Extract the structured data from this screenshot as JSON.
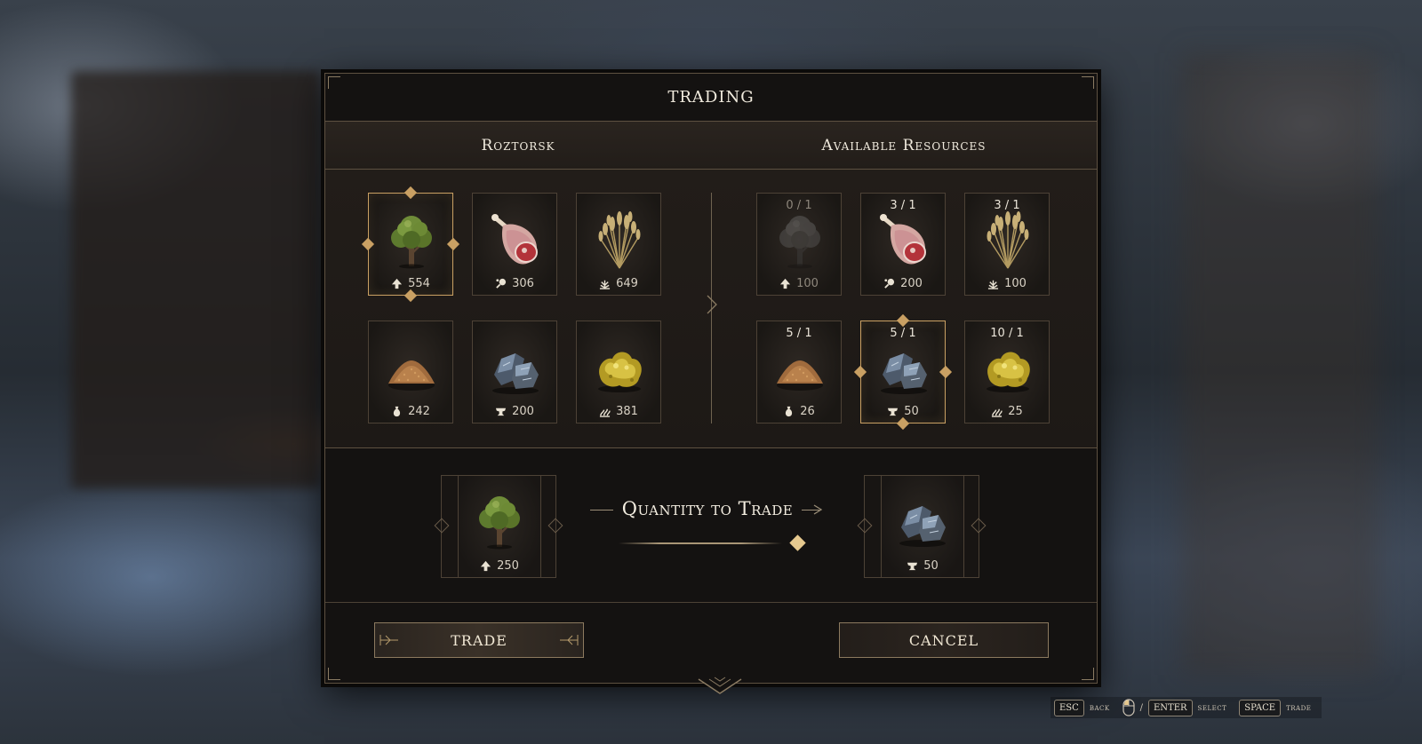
{
  "dialog": {
    "title": "TRADING",
    "left_header": "Roztorsk",
    "right_header": "Available Resources"
  },
  "left_resources": [
    {
      "icon": "tree-icon",
      "count_icon": "wood-icon",
      "count": "554",
      "selected": true
    },
    {
      "icon": "meat-icon",
      "count_icon": "meat-small-icon",
      "count": "306",
      "selected": false
    },
    {
      "icon": "wheat-icon",
      "count_icon": "grain-icon",
      "count": "649",
      "selected": false
    },
    {
      "icon": "sawdust-icon",
      "count_icon": "sack-icon",
      "count": "242",
      "selected": false
    },
    {
      "icon": "stone-ore-icon",
      "count_icon": "anvil-icon",
      "count": "200",
      "selected": false
    },
    {
      "icon": "gold-ore-icon",
      "count_icon": "sulfur-icon",
      "count": "381",
      "selected": false
    }
  ],
  "right_resources": [
    {
      "icon": "tree-icon",
      "count_icon": "wood-icon",
      "ratio": "0 / 1",
      "count": "100",
      "selected": false,
      "disabled": true
    },
    {
      "icon": "meat-icon",
      "count_icon": "meat-small-icon",
      "ratio": "3 / 1",
      "count": "200",
      "selected": false,
      "disabled": false
    },
    {
      "icon": "wheat-icon",
      "count_icon": "grain-icon",
      "ratio": "3 / 1",
      "count": "100",
      "selected": false,
      "disabled": false
    },
    {
      "icon": "sawdust-icon",
      "count_icon": "sack-icon",
      "ratio": "5 / 1",
      "count": "26",
      "selected": false,
      "disabled": false
    },
    {
      "icon": "stone-ore-icon",
      "count_icon": "anvil-icon",
      "ratio": "5 / 1",
      "count": "50",
      "selected": true,
      "disabled": false
    },
    {
      "icon": "gold-ore-icon",
      "count_icon": "sulfur-icon",
      "ratio": "10 / 1",
      "count": "25",
      "selected": false,
      "disabled": false
    }
  ],
  "trade": {
    "quantity_label": "Quantity to Trade",
    "from_count": "250",
    "to_count": "50",
    "slider_level": 1.0
  },
  "buttons": {
    "trade": "TRADE",
    "cancel": "CANCEL"
  },
  "hotkeys": {
    "back_key": "ESC",
    "back_label": "back",
    "separator": "/",
    "select_key": "ENTER",
    "select_label": "select",
    "trade_key": "SPACE",
    "trade_label": "trade"
  },
  "colors": {
    "accent": "#c9a063",
    "panel_bg": "#141211",
    "border": "#5e5141"
  }
}
